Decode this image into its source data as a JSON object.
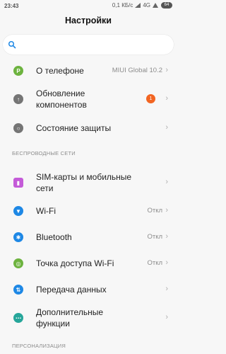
{
  "status_bar": {
    "time": "23:43",
    "speed": "0,1 КБ/с",
    "network": "4G",
    "battery": "64"
  },
  "header": {
    "title": "Настройки"
  },
  "search": {
    "placeholder": ""
  },
  "items": [
    {
      "label": "О телефоне",
      "value": "MIUI Global 10.2",
      "icon": "phone-info-icon",
      "color": "#6db33f"
    },
    {
      "label": "Обновление компонентов",
      "badge": "1",
      "icon": "update-icon",
      "color": "#757575"
    },
    {
      "label": "Состояние защиты",
      "icon": "shield-icon",
      "color": "#757575"
    },
    {
      "label": "SIM-карты и мобильные сети",
      "icon": "sim-card-icon",
      "color": "#c45bd8"
    },
    {
      "label": "Wi-Fi",
      "value": "Откл",
      "icon": "wifi-icon",
      "color": "#1e88e5"
    },
    {
      "label": "Bluetooth",
      "value": "Откл",
      "icon": "bluetooth-icon",
      "color": "#1e88e5"
    },
    {
      "label": "Точка доступа Wi-Fi",
      "value": "Откл",
      "icon": "hotspot-icon",
      "color": "#6db33f"
    },
    {
      "label": "Передача данных",
      "icon": "data-transfer-icon",
      "color": "#1e88e5"
    },
    {
      "label": "Дополнительные функции",
      "icon": "more-icon",
      "color": "#26a69a"
    }
  ],
  "sections": {
    "wireless": "БЕСПРОВОДНЫЕ СЕТИ",
    "personalization": "ПЕРСОНАЛИЗАЦИЯ"
  }
}
